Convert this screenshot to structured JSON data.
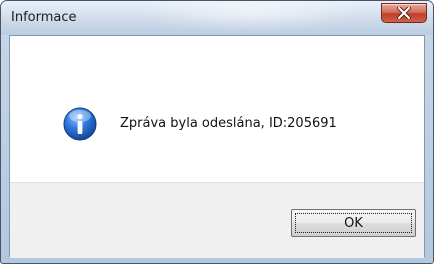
{
  "window": {
    "title": "Informace",
    "close_icon": "close-icon"
  },
  "dialog": {
    "icon": "info-icon",
    "message": "Zpráva byla odeslána, ID:205691",
    "ok_label": "OK"
  },
  "colors": {
    "close_button": "#c8452f",
    "info_icon": "#1c5fbf"
  }
}
